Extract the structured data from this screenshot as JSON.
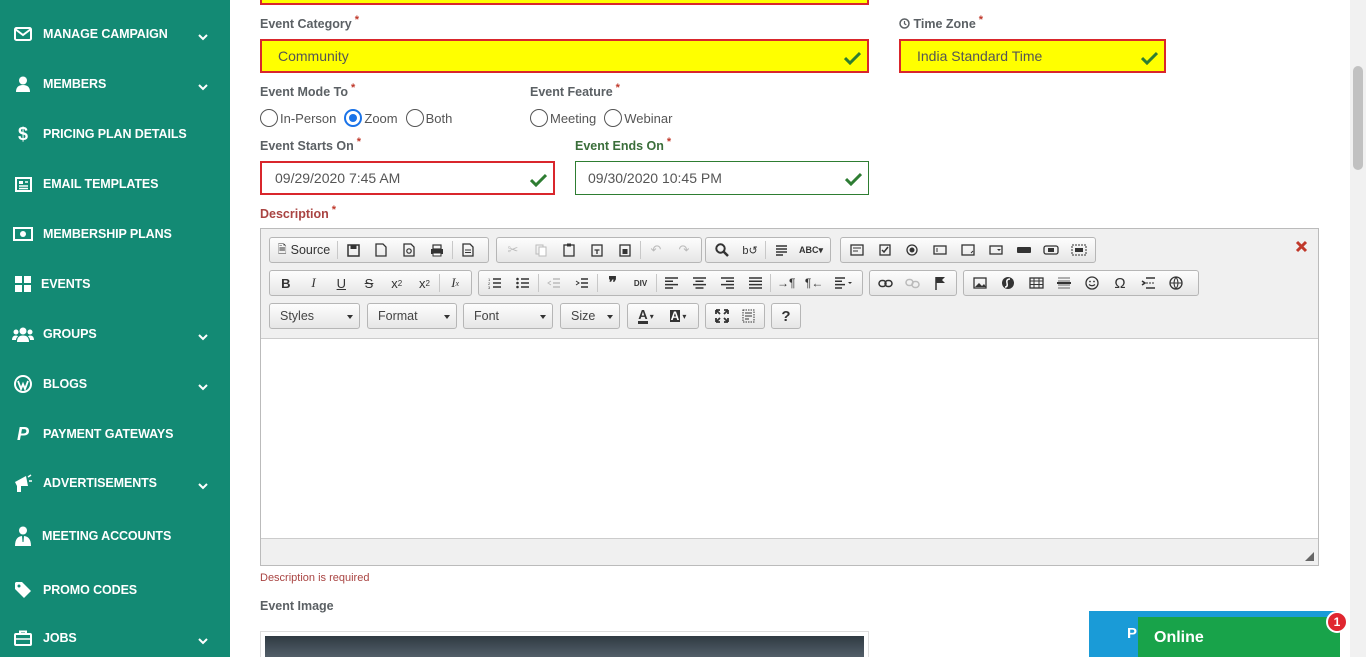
{
  "sidebar": {
    "items": [
      {
        "label": "MANAGE CAMPAIGN",
        "icon": "envelope-icon",
        "has_chevron": true
      },
      {
        "label": "MEMBERS",
        "icon": "user-icon",
        "has_chevron": true
      },
      {
        "label": "PRICING PLAN DETAILS",
        "icon": "dollar-icon",
        "has_chevron": false
      },
      {
        "label": "EMAIL TEMPLATES",
        "icon": "newspaper-icon",
        "has_chevron": false
      },
      {
        "label": "MEMBERSHIP PLANS",
        "icon": "money-bill-icon",
        "has_chevron": false
      },
      {
        "label": "EVENTS",
        "icon": "grid-icon",
        "has_chevron": false
      },
      {
        "label": "GROUPS",
        "icon": "users-icon",
        "has_chevron": true
      },
      {
        "label": "BLOGS",
        "icon": "wordpress-icon",
        "has_chevron": true
      },
      {
        "label": "PAYMENT GATEWAYS",
        "icon": "paypal-icon",
        "has_chevron": false
      },
      {
        "label": "ADVERTISEMENTS",
        "icon": "bullhorn-icon",
        "has_chevron": true
      },
      {
        "label": "MEETING ACCOUNTS",
        "icon": "user-tie-icon",
        "has_chevron": false
      },
      {
        "label": "PROMO CODES",
        "icon": "tag-icon",
        "has_chevron": false
      },
      {
        "label": "JOBS",
        "icon": "briefcase-icon",
        "has_chevron": true
      }
    ]
  },
  "form": {
    "category": {
      "label": "Event Category",
      "value": "Community"
    },
    "timezone": {
      "label": "Time Zone",
      "value": "India Standard Time"
    },
    "mode": {
      "label": "Event Mode To",
      "options": [
        "In-Person",
        "Zoom",
        "Both"
      ],
      "selected": "Zoom"
    },
    "feature": {
      "label": "Event Feature",
      "options": [
        "Meeting",
        "Webinar"
      ],
      "selected": ""
    },
    "starts": {
      "label": "Event Starts On",
      "value": "09/29/2020 7:45 AM"
    },
    "ends": {
      "label": "Event Ends On",
      "value": "09/30/2020 10:45 PM"
    },
    "description": {
      "label": "Description",
      "error": "Description is required"
    },
    "image": {
      "label": "Event Image"
    },
    "required_mark": "*"
  },
  "editor": {
    "source_label": "Source",
    "styles_label": "Styles",
    "format_label": "Format",
    "font_label": "Font",
    "size_label": "Size",
    "help_label": "?"
  },
  "chat": {
    "status": "Online",
    "badge": "1",
    "button_partial": "Pr"
  },
  "colors": {
    "sidebar": "#138a74",
    "error": "#d9262c",
    "highlight": "#ffff00",
    "valid": "#2e7d32",
    "chat": "#18a34a",
    "accent": "#1a9bd7"
  }
}
